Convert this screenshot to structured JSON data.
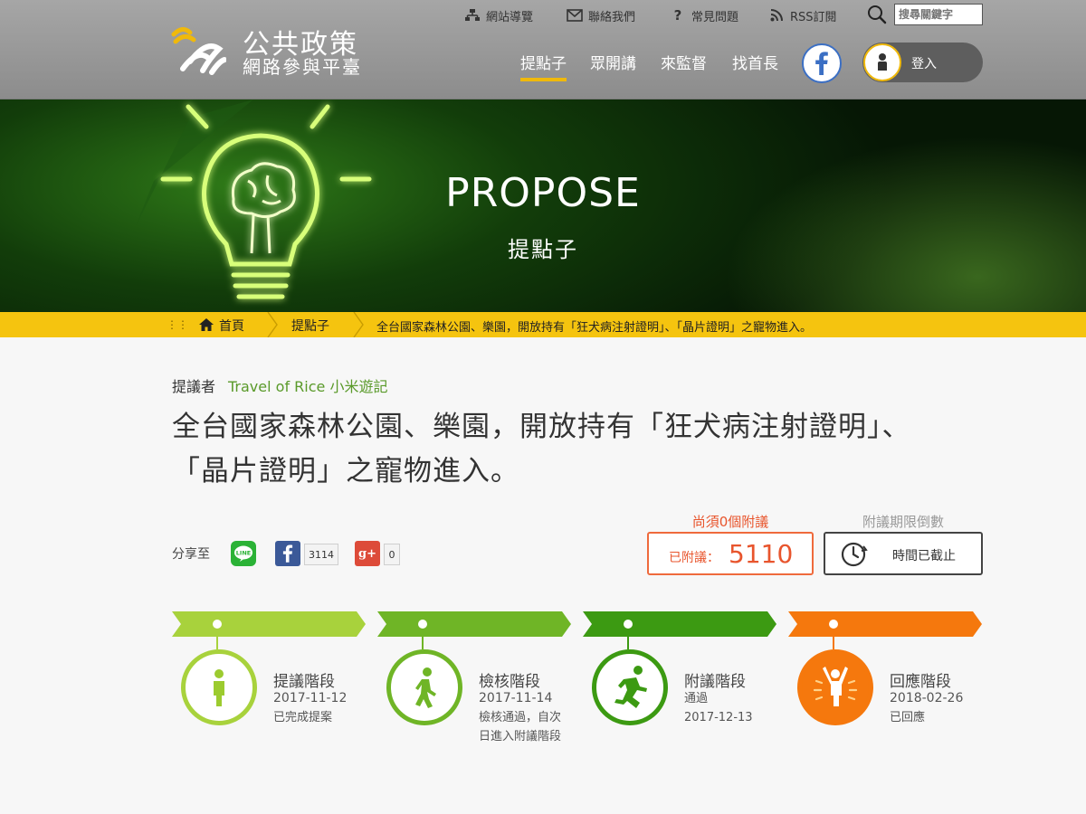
{
  "site": {
    "title": "公共政策",
    "subtitle": "網路參與平臺"
  },
  "utility": {
    "sitemap": "網站導覽",
    "contact": "聯絡我們",
    "faq": "常見問題",
    "rss": "RSS訂閱",
    "search_placeholder": "搜尋關鍵字"
  },
  "nav": {
    "items": [
      {
        "label": "提點子",
        "active": true
      },
      {
        "label": "眾開講",
        "active": false
      },
      {
        "label": "來監督",
        "active": false
      },
      {
        "label": "找首長",
        "active": false
      }
    ],
    "login": "登入"
  },
  "banner": {
    "title": "PROPOSE",
    "subtitle": "提點子"
  },
  "breadcrumb": {
    "home": "首頁",
    "section": "提點子",
    "current": "全台國家森林公園、樂園，開放持有「狂犬病注射證明」、「晶片證明」之寵物進入。"
  },
  "proposal": {
    "proposer_label": "提議者",
    "proposer": "Travel of Rice 小米遊記",
    "title": "全台國家森林公園、樂園，開放持有「狂犬病注射證明」、「晶片證明」之寵物進入。"
  },
  "share": {
    "label": "分享至",
    "line": "LINE",
    "facebook_count": "3114",
    "gplus_count": "0"
  },
  "signatures": {
    "need_label": "尚須0個附議",
    "signed_label": "已附議：",
    "signed_count": "5110"
  },
  "deadline": {
    "label": "附議期限倒數",
    "status": "時間已截止"
  },
  "stages": [
    {
      "name": "提議階段",
      "date": "2017-11-12",
      "status": [
        "已完成提案"
      ],
      "color": "#a8d23c",
      "icon": "standing-person-icon"
    },
    {
      "name": "檢核階段",
      "date": "2017-11-14",
      "status": [
        "檢核通過，自次",
        "日進入附議階段"
      ],
      "color": "#6fb526",
      "icon": "walking-person-icon"
    },
    {
      "name": "附議階段",
      "date": "2017-12-13",
      "status": [
        "通過"
      ],
      "color": "#3c9a12",
      "icon": "running-person-icon"
    },
    {
      "name": "回應階段",
      "date": "2018-02-26",
      "status": [
        "已回應"
      ],
      "color": "#f5780d",
      "icon": "cheering-person-icon"
    }
  ],
  "colors": {
    "accent": "#f5c40f",
    "proposer": "#5a9a2a",
    "signature": "#e8552d"
  }
}
